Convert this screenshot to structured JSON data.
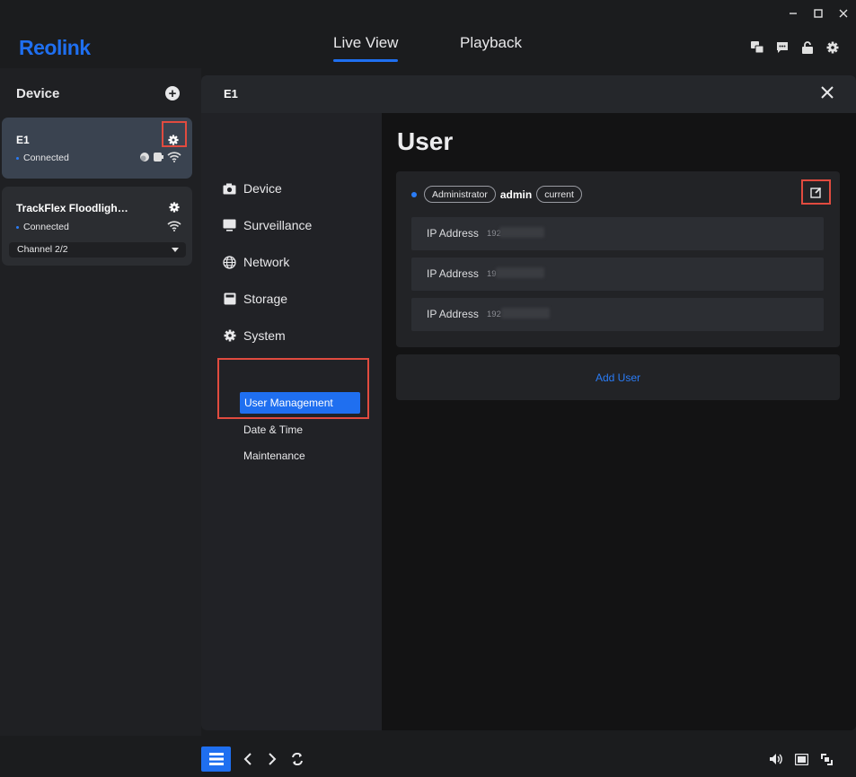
{
  "header": {
    "logo": "Reolink",
    "tabs": [
      {
        "label": "Live View",
        "active": true
      },
      {
        "label": "Playback",
        "active": false
      }
    ]
  },
  "device_panel": {
    "title": "Device",
    "devices": [
      {
        "name": "E1",
        "status": "Connected"
      },
      {
        "name": "TrackFlex Floodligh…",
        "status": "Connected",
        "channel": "Channel 2/2"
      }
    ]
  },
  "modal": {
    "title": "E1",
    "menu": [
      {
        "label": "Device",
        "icon": "camera-icon"
      },
      {
        "label": "Surveillance",
        "icon": "monitor-icon"
      },
      {
        "label": "Network",
        "icon": "globe-icon"
      },
      {
        "label": "Storage",
        "icon": "storage-icon"
      },
      {
        "label": "System",
        "icon": "gear-icon"
      }
    ],
    "system_submenu": [
      {
        "label": "User Management",
        "active": true
      },
      {
        "label": "Date & Time",
        "active": false
      },
      {
        "label": "Maintenance",
        "active": false
      }
    ]
  },
  "user_page": {
    "title": "User",
    "user": {
      "role": "Administrator",
      "name": "admin",
      "tag": "current"
    },
    "ip_rows": [
      {
        "label": "IP Address",
        "value": "192"
      },
      {
        "label": "IP Address",
        "value": "19"
      },
      {
        "label": "IP Address",
        "value": "192"
      }
    ],
    "add_user_label": "Add User"
  },
  "colors": {
    "accent": "#1f6ff0",
    "highlight_box": "#e14b3f",
    "status_dot": "#2a7cf6"
  }
}
